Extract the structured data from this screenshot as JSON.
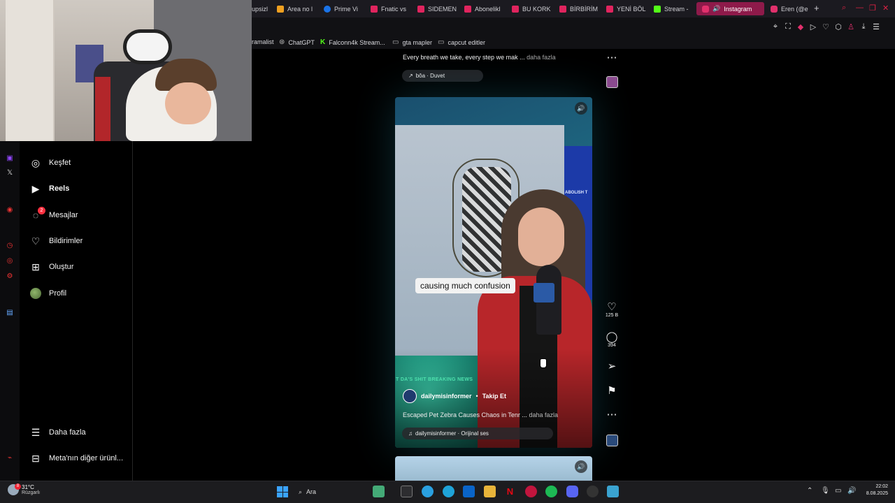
{
  "browser": {
    "tabs": [
      {
        "label": "upsizl",
        "color": "#e33"
      },
      {
        "label": "Area no l",
        "color": "#f0a020"
      },
      {
        "label": "Prime Vi",
        "color": "#1a73e8"
      },
      {
        "label": "Fnatic vs",
        "color": "#e0245e"
      },
      {
        "label": "SIDEMEN",
        "color": "#e0245e"
      },
      {
        "label": "Abonelikl",
        "color": "#e0245e"
      },
      {
        "label": "BU KORK",
        "color": "#e0245e"
      },
      {
        "label": "BİRBİRİM",
        "color": "#e0245e"
      },
      {
        "label": "YENİ BÖL",
        "color": "#e0245e"
      },
      {
        "label": "Stream -",
        "color": "#53fc18"
      },
      {
        "label": "Instagram",
        "color": "#e1306c"
      },
      {
        "label": "Eren (@e",
        "color": "#e1306c"
      }
    ],
    "new_tab": "+",
    "bookmarks": [
      {
        "label": "ramalist",
        "icon": "text"
      },
      {
        "label": "ChatGPT",
        "icon": "chatgpt-icon"
      },
      {
        "label": "Falconn4k Stream...",
        "icon": "kick-icon"
      },
      {
        "label": "gta mapler",
        "icon": "folder-icon"
      },
      {
        "label": "capcut editler",
        "icon": "folder-icon"
      }
    ]
  },
  "nav": {
    "items": [
      {
        "label": "Keşfet",
        "icon": "compass-icon"
      },
      {
        "label": "Reels",
        "icon": "reels-icon"
      },
      {
        "label": "Mesajlar",
        "icon": "messenger-icon",
        "badge": "2"
      },
      {
        "label": "Bildirimler",
        "icon": "heart-icon"
      },
      {
        "label": "Oluştur",
        "icon": "plus-square-icon"
      },
      {
        "label": "Profil",
        "icon": "avatar"
      }
    ],
    "more": "Daha fazla",
    "meta": "Meta'nın diğer ürünl..."
  },
  "feed": {
    "prev_caption": "Every breath we take, every step we mak ...",
    "prev_more": "daha fazla",
    "prev_audio": "bôa · Duvet",
    "subtitle": "causing much confusion",
    "ticker": "T DA'S SHIT  BREAKING NEWS",
    "screen_text": "ABOLISH T",
    "author": "dailymisinformer",
    "dot": "•",
    "follow": "Takip Et",
    "caption": "Escaped Pet Zebra Causes Chaos in Tenr ...",
    "caption_more": "daha fazla",
    "audio": "dailymisinformer · Orijinal ses",
    "likes": "125 B",
    "comments": "394"
  },
  "taskbar": {
    "temp": "31°C",
    "condition": "Rüzgarlı",
    "weather_badge": "8",
    "search": "Ara",
    "time": "22:02",
    "date": "8.08.2025"
  },
  "colors": {
    "accent_tab": "#8e1a4a",
    "badge": "#ff3040"
  }
}
